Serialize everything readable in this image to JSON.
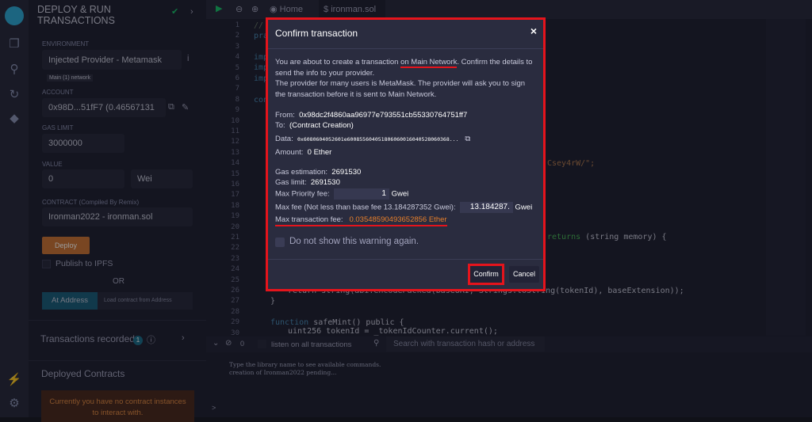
{
  "sidebar": {
    "title_line1": "DEPLOY & RUN",
    "title_line2": "TRANSACTIONS",
    "environment_label": "ENVIRONMENT",
    "environment_value": "Injected Provider - Metamask",
    "network_badge": "Main (1) network",
    "account_label": "ACCOUNT",
    "account_value": "0x98D...51fF7 (0.46567131",
    "gas_limit_label": "GAS LIMIT",
    "gas_limit_value": "3000000",
    "value_label": "VALUE",
    "value_amount": "0",
    "value_unit": "Wei",
    "contract_label": "CONTRACT",
    "contract_label_note": "(Compiled By Remix)",
    "contract_value": "Ironman2022 - ironman.sol",
    "deploy_label": "Deploy",
    "publish_label": "Publish to IPFS",
    "or_label": "OR",
    "at_address_label": "At Address",
    "at_address_placeholder": "Load contract from Address",
    "transactions_recorded_label": "Transactions recorded",
    "transactions_recorded_count": "1",
    "deployed_contracts_label": "Deployed Contracts",
    "no_instances_message": "Currently you have no contract instances to interact with."
  },
  "tabs": [
    {
      "label": "Home"
    },
    {
      "label": "ironman.sol"
    }
  ],
  "editor": {
    "line_numbers": [
      "1",
      "2",
      "3",
      "4",
      "5",
      "6",
      "7",
      "8",
      "9",
      "10",
      "11",
      "12",
      "13",
      "14",
      "15",
      "16",
      "17",
      "18",
      "19",
      "20",
      "21",
      "22",
      "23",
      "24",
      "25",
      "26",
      "27",
      "28",
      "29",
      "30"
    ],
    "visible_code": {
      "l1": "//",
      "l2": "pra",
      "l4": "imp",
      "l5": "imp",
      "l6": "imp",
      "l8": "con",
      "l14": "Csey4rW/\";",
      "l21_returns": "returns",
      "l21_rest": " (string memory) {",
      "l26": "return string(abi.encodePacked(baseURI, Strings.toString(tokenId), baseExtension));",
      "l27": "}",
      "l29_fn": "function",
      "l29_rest": " safeMint() public {",
      "l30": "uint256 tokenId = _tokenIdCounter.current();"
    }
  },
  "terminal": {
    "count": "0",
    "listen_label": "listen on all transactions",
    "search_placeholder": "Search with transaction hash or address",
    "lines": [
      "Type the library name to see available commands.",
      "creation of Ironman2022 pending..."
    ],
    "prompt": ">"
  },
  "modal": {
    "title": "Confirm transaction",
    "close": "×",
    "intro_pre": "You are about to create a transaction ",
    "intro_network": "on Main Network",
    "intro_post": ". Confirm the details to send the info to your provider.",
    "intro2": "The provider for many users is MetaMask. The provider will ask you to sign the transaction before it is sent to Main Network.",
    "from_label": "From:",
    "from_value": "0x98dc2f4860aa96977e793551cb55330764751ff7",
    "to_label": "To:",
    "to_value": "(Contract Creation)",
    "data_label": "Data:",
    "data_value": "0x6080604052601e600855604051806060016040528060368...",
    "amount_label": "Amount:",
    "amount_value": "0 Ether",
    "gas_estimation_label": "Gas estimation:",
    "gas_estimation_value": "2691530",
    "gas_limit_label": "Gas limit:",
    "gas_limit_value": "2691530",
    "max_priority_label": "Max Priority fee:",
    "max_priority_value": "1",
    "gwei1": "Gwei",
    "max_fee_label": "Max fee (Not less than base fee 13.184287352 Gwei):",
    "max_fee_value": "13.184287.",
    "gwei2": "Gwei",
    "max_tx_fee_label": "Max transaction fee:",
    "max_tx_fee_value": "0.03548590493652856 Ether",
    "dont_show_label": "Do not show this warning again.",
    "confirm_label": "Confirm",
    "cancel_label": "Cancel"
  },
  "colors": {
    "highlight": "#e5141c",
    "fee": "#e87f2a",
    "deploy": "#c97539",
    "accent": "#1bc16d"
  }
}
